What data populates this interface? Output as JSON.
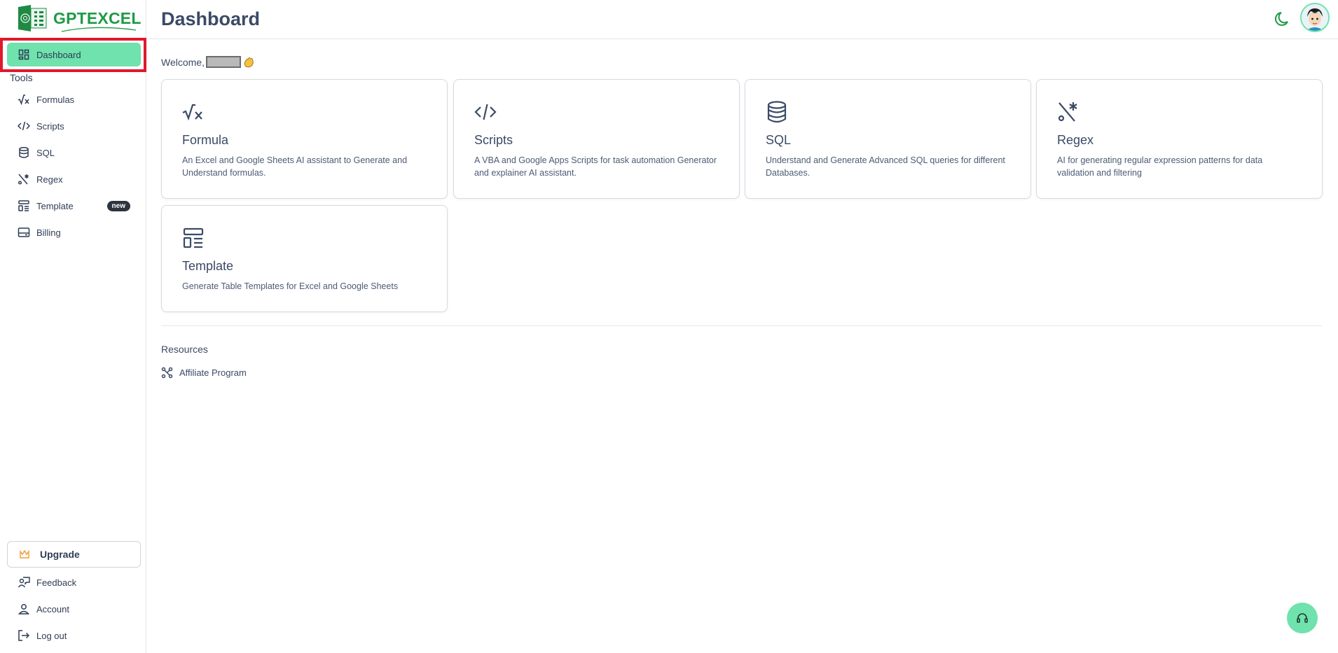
{
  "app": {
    "brand": "GPTEXCEL"
  },
  "header": {
    "title": "Dashboard"
  },
  "sidebar": {
    "active_item": "Dashboard",
    "section_label": "Tools",
    "items": [
      {
        "label": "Formulas",
        "icon": "sqrt-x-icon"
      },
      {
        "label": "Scripts",
        "icon": "code-icon"
      },
      {
        "label": "SQL",
        "icon": "database-icon"
      },
      {
        "label": "Regex",
        "icon": "regex-icon"
      },
      {
        "label": "Template",
        "icon": "template-icon",
        "badge": "new"
      },
      {
        "label": "Billing",
        "icon": "card-icon"
      }
    ],
    "upgrade_label": "Upgrade",
    "bottom_items": [
      {
        "label": "Feedback",
        "icon": "feedback-icon"
      },
      {
        "label": "Account",
        "icon": "user-icon"
      },
      {
        "label": "Log out",
        "icon": "logout-icon"
      }
    ]
  },
  "main": {
    "welcome_prefix": "Welcome,",
    "cards": [
      {
        "title": "Formula",
        "description": "An Excel and Google Sheets AI assistant to Generate and Understand formulas.",
        "icon": "sqrt-x-icon"
      },
      {
        "title": "Scripts",
        "description": "A VBA and Google Apps Scripts for task automation Generator and explainer AI assistant.",
        "icon": "code-icon"
      },
      {
        "title": "SQL",
        "description": "Understand and Generate Advanced SQL queries for different Databases.",
        "icon": "database-icon"
      },
      {
        "title": "Regex",
        "description": "AI for generating regular expression patterns for data validation and filtering",
        "icon": "regex-icon"
      },
      {
        "title": "Template",
        "description": "Generate Table Templates for Excel and Google Sheets",
        "icon": "template-icon"
      }
    ],
    "resources_title": "Resources",
    "resources": [
      {
        "label": "Affiliate Program",
        "icon": "affiliate-icon"
      }
    ]
  },
  "colors": {
    "accent": "#6fe2ae",
    "brand_green": "#1f9a47",
    "highlight_red": "#e0192e",
    "text": "#3b4a66"
  }
}
